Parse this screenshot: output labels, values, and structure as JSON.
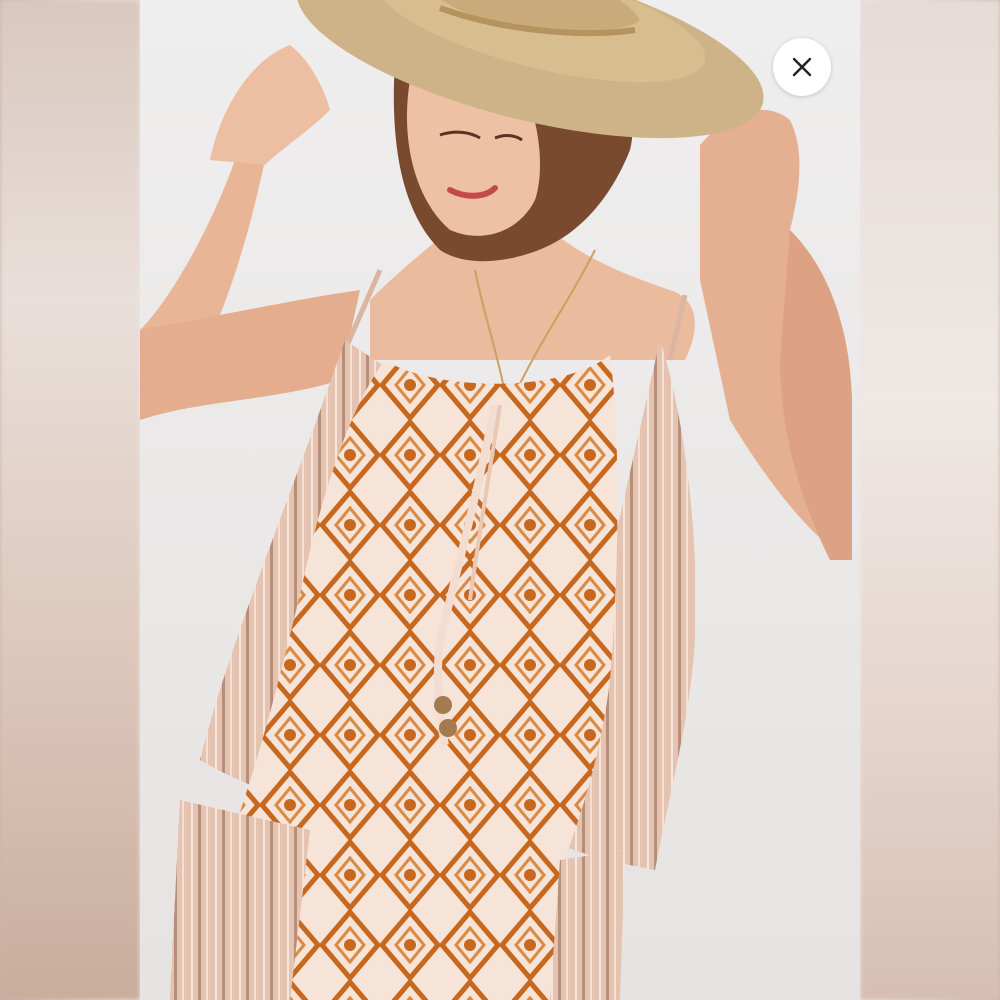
{
  "viewer": {
    "image_description_icons": {
      "close": "close-icon"
    }
  },
  "colors": {
    "overlay_background": "#efe7e3",
    "close_button_bg": "#ffffff",
    "close_icon": "#222222",
    "garment_base": "#f3ddd0",
    "garment_pattern": "#c8681f",
    "garment_stripe": "#d9b5a2",
    "hat": "#d8bd8f",
    "skin": "#e9b89c",
    "hair": "#7a4a2e"
  }
}
